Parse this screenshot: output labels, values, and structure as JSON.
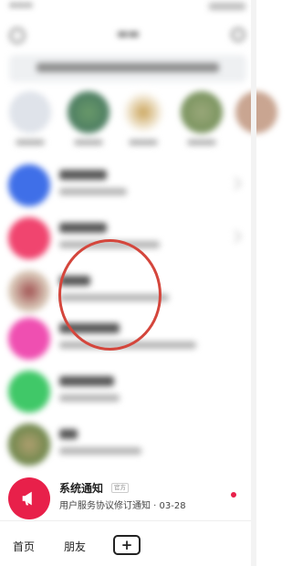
{
  "rows_above": [
    {
      "id": "r1",
      "avatar_color": "#3f6fe8"
    },
    {
      "id": "r2",
      "avatar_color": "#f0456f"
    },
    {
      "id": "r3",
      "avatar_color": "#b49a88"
    },
    {
      "id": "r4",
      "avatar_color": "#ef4fb1"
    },
    {
      "id": "r5",
      "avatar_color": "#40c868"
    },
    {
      "id": "r6",
      "avatar_color": "#5a8a40"
    }
  ],
  "system_notice": {
    "name": "系统通知",
    "tag": "官方",
    "message": "用户服务协议修订通知 · 03-28",
    "icon": "megaphone-icon",
    "avatar_color": "#e8204a",
    "unread_dot_color": "#e8204a"
  },
  "bottom_nav": {
    "home": "首页",
    "friends": "朋友",
    "add": "+"
  },
  "annotation_color": "#d4463c"
}
